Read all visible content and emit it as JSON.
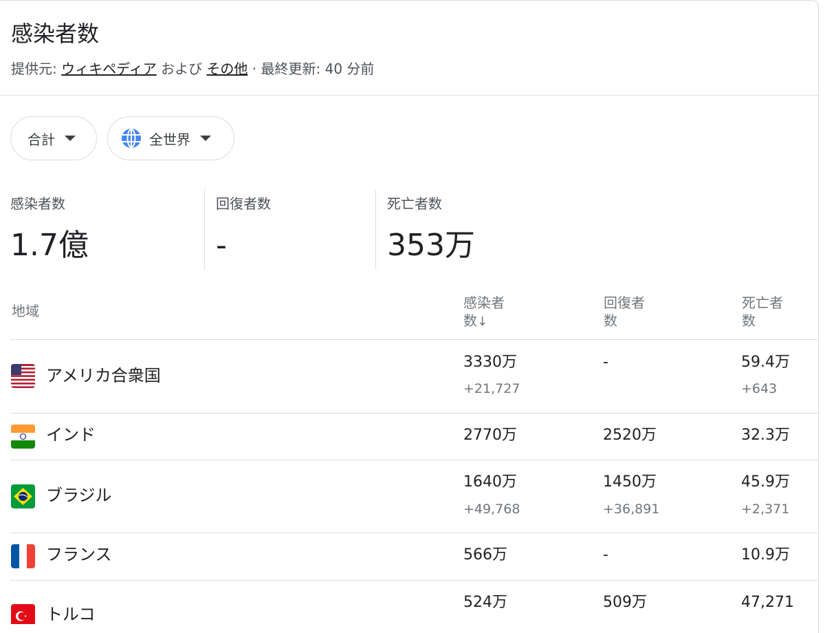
{
  "header": {
    "title": "感染者数",
    "source_prefix": "提供元: ",
    "source_link1": "ウィキペディア",
    "source_and": " および ",
    "source_link2": "その他",
    "source_update": " · 最終更新: 40 分前"
  },
  "filters": {
    "period": "合計",
    "region": "全世界"
  },
  "stats": [
    {
      "label": "感染者数",
      "value": "1.7億"
    },
    {
      "label": "回復者数",
      "value": "-"
    },
    {
      "label": "死亡者数",
      "value": "353万"
    }
  ],
  "table": {
    "headers": {
      "region": "地域",
      "cases_line1": "感染者",
      "cases_line2": "数",
      "sort_arrow": "↓",
      "recovered_line1": "回復者",
      "recovered_line2": "数",
      "deaths_line1": "死亡者",
      "deaths_line2": "数"
    },
    "rows": [
      {
        "country": "アメリカ合衆国",
        "flag": "us-flag",
        "cases": "3330万",
        "cases_delta": "+21,727",
        "recovered": "-",
        "recovered_delta": "",
        "deaths": "59.4万",
        "deaths_delta": "+643"
      },
      {
        "country": "インド",
        "flag": "india-flag",
        "cases": "2770万",
        "cases_delta": "",
        "recovered": "2520万",
        "recovered_delta": "",
        "deaths": "32.3万",
        "deaths_delta": ""
      },
      {
        "country": "ブラジル",
        "flag": "brazil-flag",
        "cases": "1640万",
        "cases_delta": "+49,768",
        "recovered": "1450万",
        "recovered_delta": "+36,891",
        "deaths": "45.9万",
        "deaths_delta": "+2,371"
      },
      {
        "country": "フランス",
        "flag": "france-flag",
        "cases": "566万",
        "cases_delta": "",
        "recovered": "-",
        "recovered_delta": "",
        "deaths": "10.9万",
        "deaths_delta": ""
      },
      {
        "country": "トルコ",
        "flag": "turkey-flag",
        "cases": "524万",
        "cases_delta": "",
        "recovered": "509万",
        "recovered_delta": "",
        "deaths": "47,271",
        "deaths_delta": ""
      }
    ]
  },
  "colors": {
    "text": "#202124",
    "secondary": "#70757a",
    "divider": "#dadce0",
    "globe_blue": "#4285f4"
  }
}
